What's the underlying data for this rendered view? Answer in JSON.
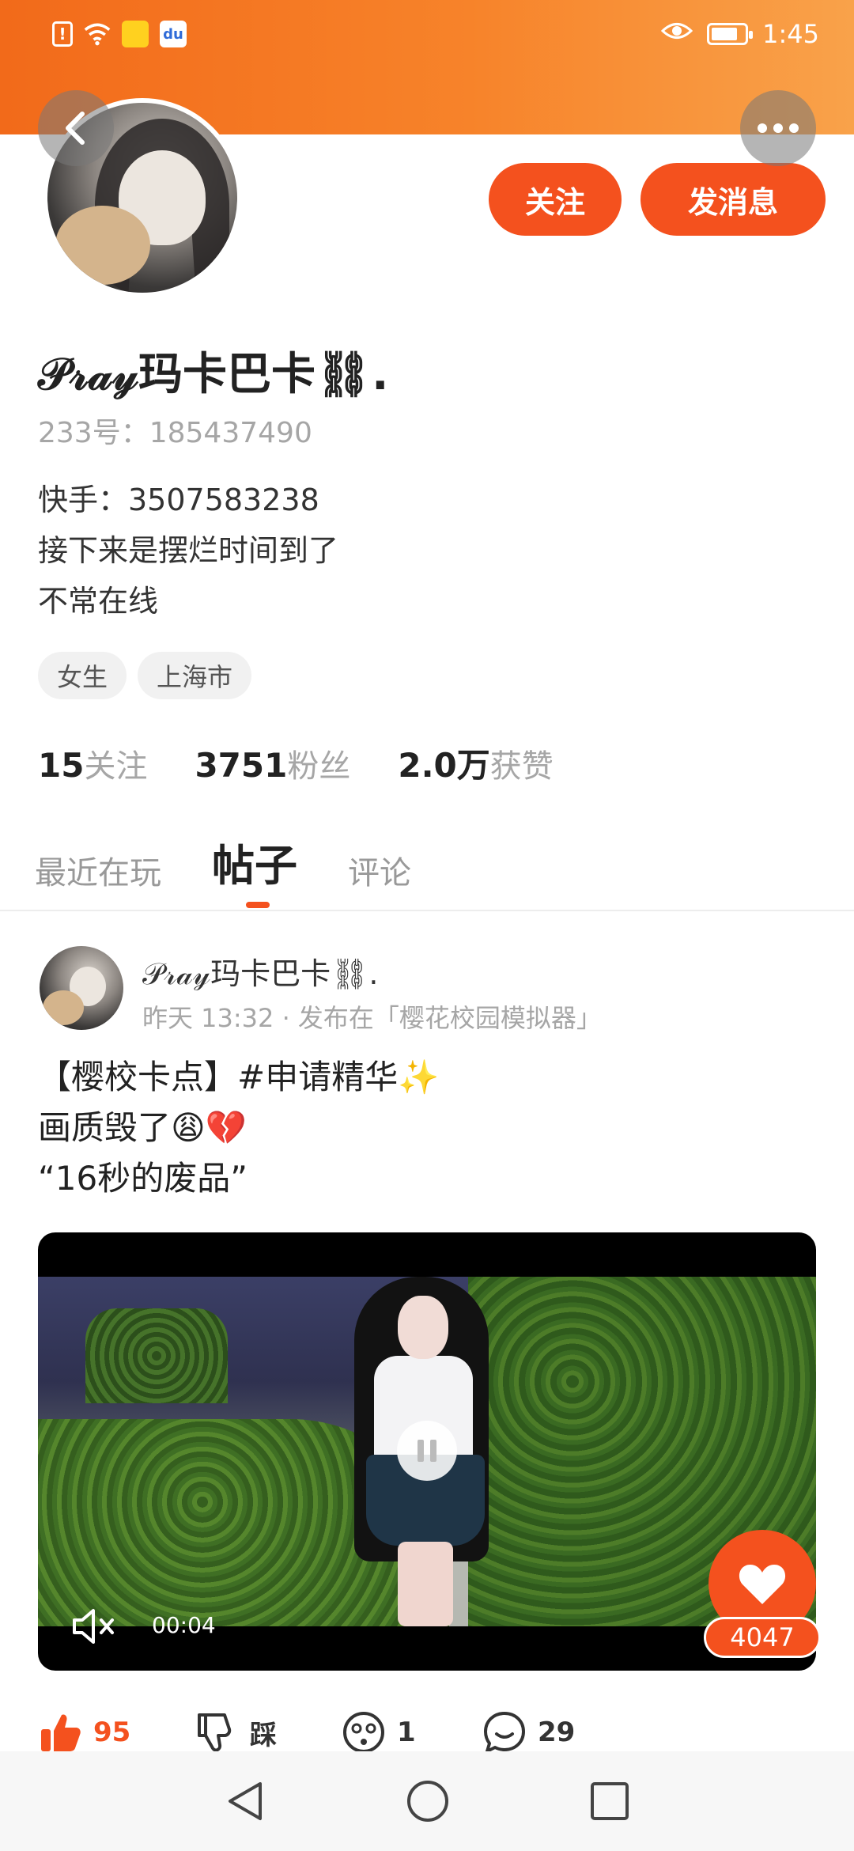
{
  "status_bar": {
    "time": "1:45",
    "icons": [
      "alert-icon",
      "wifi-icon",
      "notification-icon",
      "baidu-icon"
    ],
    "battery_level": 0.8
  },
  "colors": {
    "accent": "#f4511e",
    "header_gradient_start": "#f26a1a",
    "header_gradient_end": "#f9a24a"
  },
  "profile": {
    "follow_label": "关注",
    "message_label": "发消息",
    "username": "𝒫𝓇𝒶𝓎玛卡巴卡⛓.",
    "id_line": "233号：185437490",
    "bio": [
      "快手：3507583238",
      "接下来是摆烂时间到了",
      "不常在线"
    ],
    "tags": [
      "女生",
      "上海市"
    ],
    "stats": [
      {
        "num": "15",
        "label": "关注"
      },
      {
        "num": "3751",
        "label": "粉丝"
      },
      {
        "num": "2.0万",
        "label": "获赞"
      }
    ]
  },
  "tabs": [
    {
      "label": "最近在玩"
    },
    {
      "label": "帖子"
    },
    {
      "label": "评论"
    }
  ],
  "post": {
    "author": "𝒫𝓇𝒶𝓎玛卡巴卡⛓.",
    "meta": "昨天 13:32 · 发布在「樱花校园模拟器」",
    "text": [
      "【樱校卡点】#申请精华✨",
      "画质毁了😩💔",
      "“16秒的废品”"
    ],
    "video_time": "00:04",
    "like_float_count": "4047",
    "actions": {
      "like_count": "95",
      "dislike_label": "踩",
      "emoji_count": "1",
      "comment_count": "29"
    }
  }
}
